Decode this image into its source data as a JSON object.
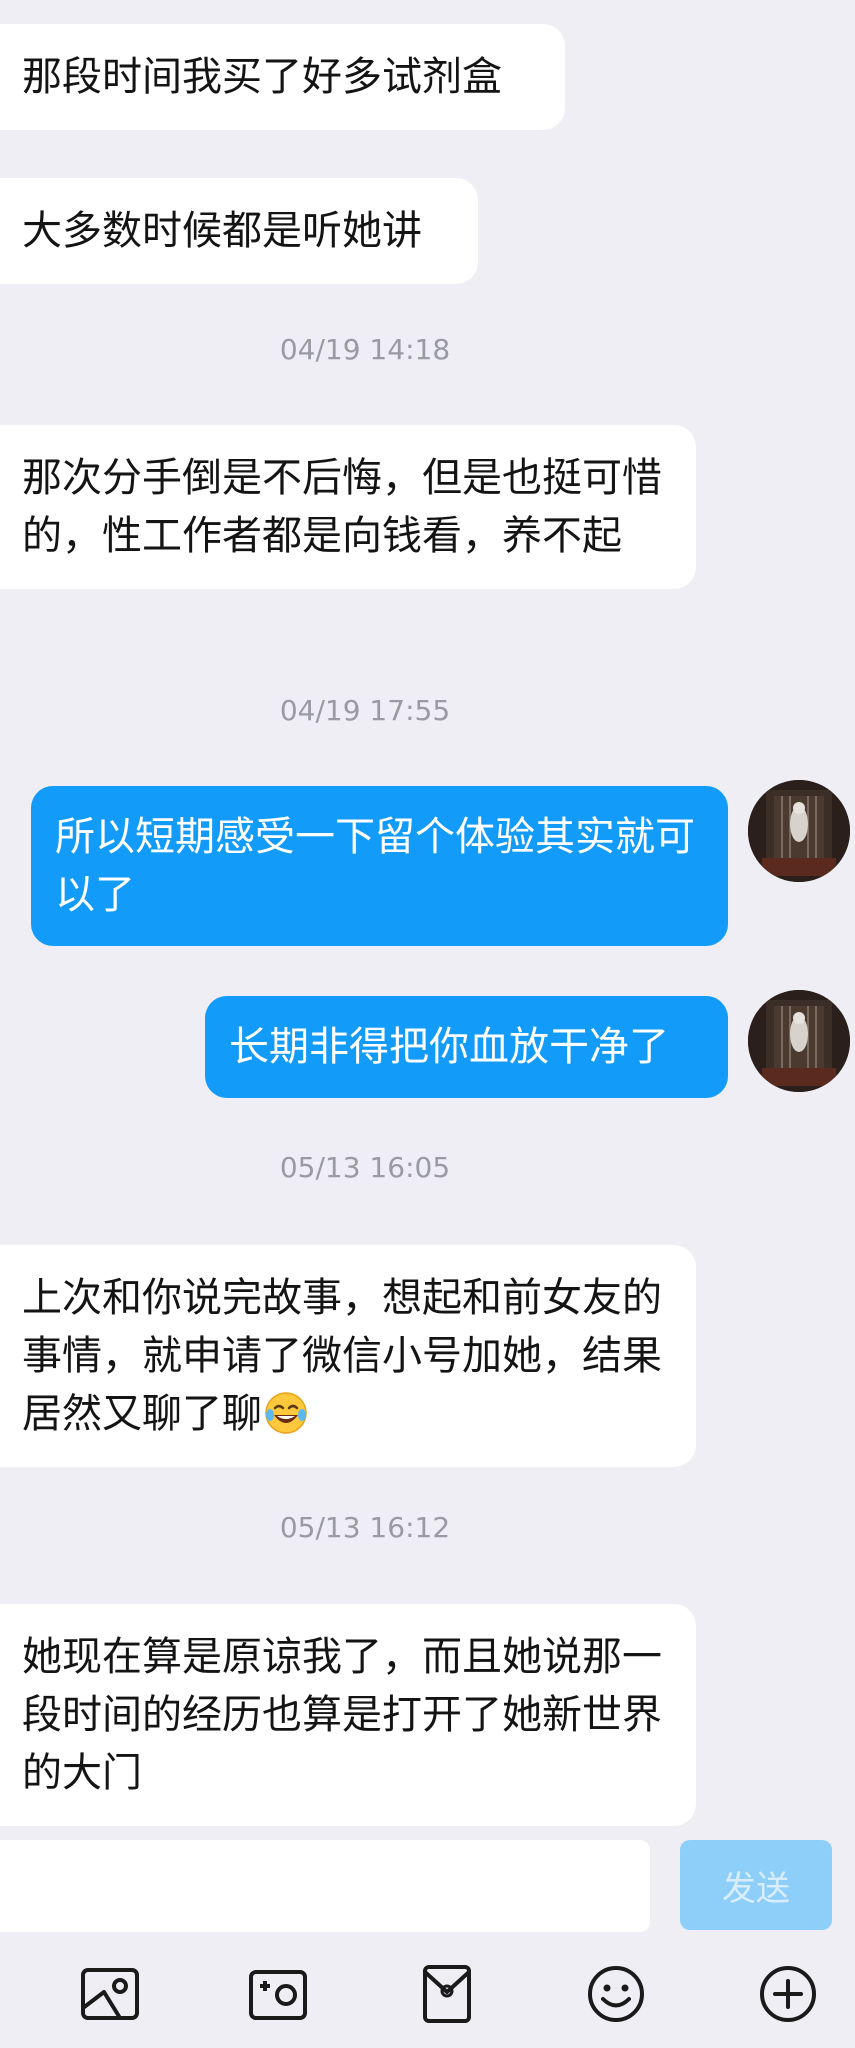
{
  "messages": [
    {
      "type": "in",
      "text": "那段时间我买了好多试剂盒"
    },
    {
      "type": "in",
      "text": "大多数时候都是听她讲"
    },
    {
      "type": "time",
      "text": "04/19 14:18"
    },
    {
      "type": "in",
      "text": "那次分手倒是不后悔，但是也挺可惜的，性工作者都是向钱看，养不起"
    },
    {
      "type": "time",
      "text": "04/19 17:55"
    },
    {
      "type": "out",
      "text": "所以短期感受一下留个体验其实就可以了"
    },
    {
      "type": "out",
      "text": "长期非得把你血放干净了"
    },
    {
      "type": "time",
      "text": "05/13 16:05"
    },
    {
      "type": "in",
      "text": "上次和你说完故事，想起和前女友的事情，就申请了微信小号加她，结果居然又聊了聊",
      "emoji": "tears-of-joy-emoji"
    },
    {
      "type": "time",
      "text": "05/13 16:12"
    },
    {
      "type": "in",
      "text": "她现在算是原谅我了，而且她说那一段时间的经历也算是打开了她新世界的大门"
    }
  ],
  "input": {
    "value": "",
    "placeholder": ""
  },
  "send_label": "发送",
  "toolbar_icons": [
    "image-icon",
    "camera-icon",
    "red-packet-icon",
    "emoji-icon",
    "plus-icon"
  ],
  "colors": {
    "background": "#eeeef4",
    "bubble_in": "#ffffff",
    "bubble_out": "#129bf9",
    "send_disabled": "#8ecffa",
    "timestamp": "#9a9aa4"
  }
}
